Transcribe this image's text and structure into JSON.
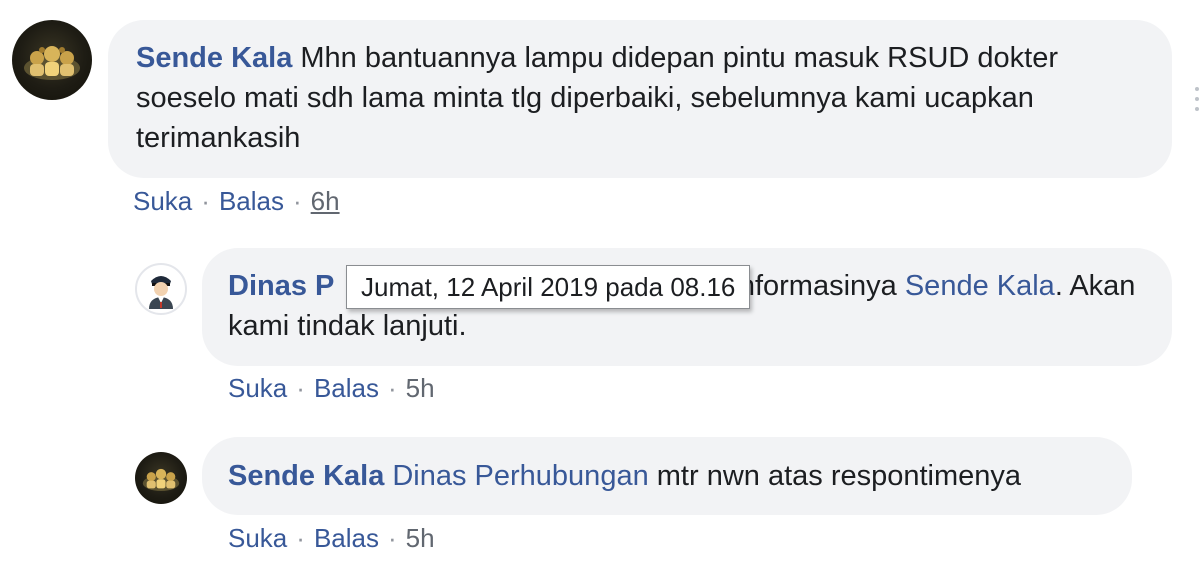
{
  "comments": [
    {
      "author": "Sende Kala",
      "text": "Mhn bantuannya lampu didepan pintu masuk RSUD dokter soeselo mati sdh lama minta tlg diperbaiki, sebelumnya kami ucapkan terimankasih",
      "actions": {
        "like": "Suka",
        "reply": "Balas",
        "time": "6h",
        "separator": "·"
      }
    },
    {
      "author": "Dinas P",
      "text_hidden_start": "",
      "text_visible": "informasinya",
      "mention": "Sende Kala",
      "text_after": ". Akan kami tindak lanjuti.",
      "actions": {
        "like": "Suka",
        "reply": "Balas",
        "time": "5h",
        "separator": "·"
      }
    },
    {
      "author": "Sende Kala",
      "mention": "Dinas Perhubungan",
      "text": "mtr nwn atas respontimenya",
      "actions": {
        "like": "Suka",
        "reply": "Balas",
        "time": "5h",
        "separator": "·"
      }
    }
  ],
  "tooltip": {
    "text": "Jumat, 12 April 2019 pada 08.16"
  },
  "icons": {
    "avatar_sende": "group-photo-avatar",
    "avatar_dinas": "police-officer-avatar"
  }
}
